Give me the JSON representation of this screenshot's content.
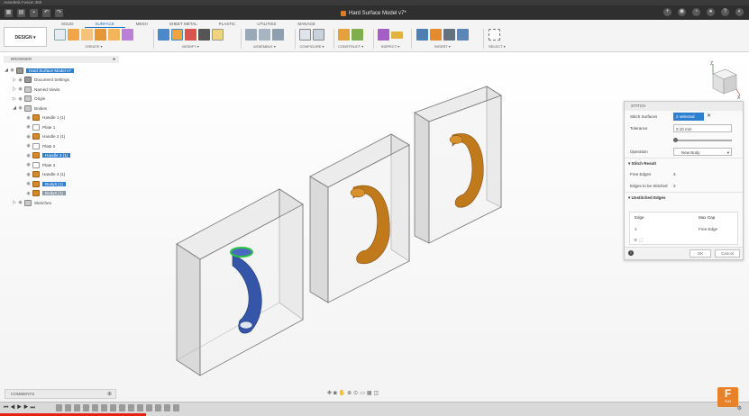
{
  "app": {
    "title": "Autodesk Fusion 360",
    "document_title": "Hard Surface Model v7*"
  },
  "toolbar": {
    "workspace": "DESIGN ▾",
    "tabs": [
      "SOLID",
      "SURFACE",
      "MESH",
      "SHEET METAL",
      "PLASTIC",
      "UTILITIES",
      "MANAGE"
    ],
    "active_tab": "SURFACE",
    "groups": [
      "CREATE ▾",
      "MODIFY ▾",
      "ASSEMBLE ▾",
      "CONFIGURE ▾",
      "CONSTRUCT ▾",
      "INSPECT ▾",
      "INSERT ▾",
      "SELECT ▾"
    ]
  },
  "browser": {
    "title": "BROWSER",
    "items": [
      {
        "label": "Hard Surface Model v7",
        "level": 0,
        "icon": "component-icon",
        "state": "selected"
      },
      {
        "label": "Document Settings",
        "level": 1,
        "icon": "gear-icon",
        "state": ""
      },
      {
        "label": "Named Views",
        "level": 1,
        "icon": "folder-icon",
        "state": ""
      },
      {
        "label": "Origin",
        "level": 1,
        "icon": "folder-icon",
        "state": ""
      },
      {
        "label": "Bodies",
        "level": 1,
        "icon": "folder-icon",
        "state": ""
      },
      {
        "label": "Handle 1 (1)",
        "level": 2,
        "icon": "body-icon",
        "state": ""
      },
      {
        "label": "Plate 1",
        "level": 2,
        "icon": "plate-icon",
        "state": ""
      },
      {
        "label": "Handle 2 (1)",
        "level": 2,
        "icon": "body-icon",
        "state": ""
      },
      {
        "label": "Plate 2",
        "level": 2,
        "icon": "plate-icon",
        "state": ""
      },
      {
        "label": "Handle 3 (1)",
        "level": 2,
        "icon": "body-icon",
        "state": "selected"
      },
      {
        "label": "Plate 3",
        "level": 2,
        "icon": "plate-icon",
        "state": ""
      },
      {
        "label": "Handle 4 (1)",
        "level": 2,
        "icon": "body-icon",
        "state": ""
      },
      {
        "label": "Body6 (1)",
        "level": 2,
        "icon": "body-icon",
        "state": "selected"
      },
      {
        "label": "Body6 (1)",
        "level": 2,
        "icon": "body-icon",
        "state": "hover"
      },
      {
        "label": "Sketches",
        "level": 1,
        "icon": "folder-icon",
        "state": ""
      }
    ]
  },
  "stitch_dialog": {
    "title": "STITCH",
    "stitch_surfaces_label": "Stitch Surfaces",
    "stitch_surfaces_value": "2 selected",
    "tolerance_label": "Tolerance",
    "tolerance_value": "0.10 mm",
    "operation_label": "Operation",
    "operation_value": "New Body",
    "stitch_result_label": "Stitch Result",
    "free_edges_label": "Free Edges",
    "free_edges_value": "3",
    "edges_to_stitch_label": "Edges to be Stitched",
    "edges_to_stitch_value": "2",
    "unstitched_label": "Unstitched Edges",
    "col_edge": "Edge",
    "col_max_gap": "Max Gap",
    "row_edge": "1",
    "row_max_gap": "Free Edge",
    "ok_label": "OK",
    "cancel_label": "Cancel"
  },
  "viewcube": {
    "axis_z": "Z",
    "axis_x": "X"
  },
  "comments": {
    "label": "COMMENTS"
  },
  "logo": {
    "letter": "F",
    "sub": "FUN"
  },
  "colors": {
    "accent": "#2f7fd0",
    "handle_orange": "#c07a1c",
    "handle_blue": "#3556a8",
    "edge_green": "#2fc24a",
    "video_progress": "#e62117"
  }
}
